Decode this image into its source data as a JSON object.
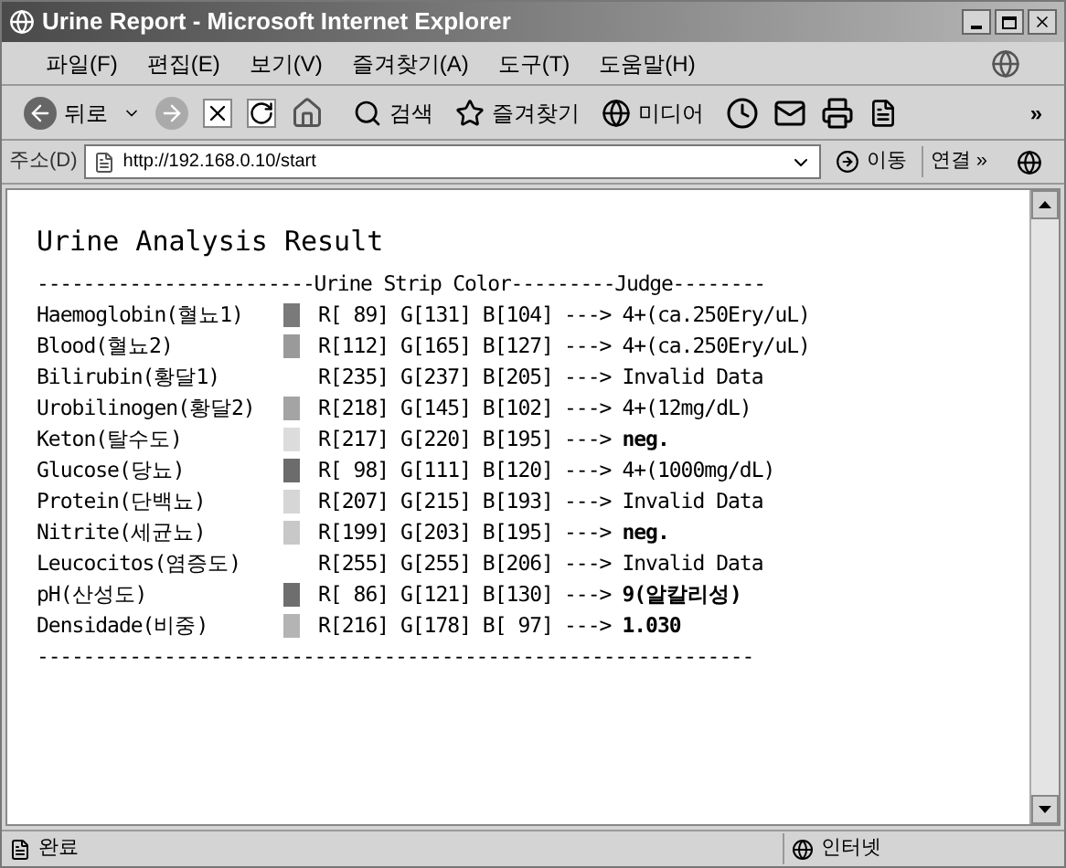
{
  "window": {
    "title": "Urine Report - Microsoft Internet Explorer"
  },
  "menu": [
    "파일(F)",
    "편집(E)",
    "보기(V)",
    "즐겨찾기(A)",
    "도구(T)",
    "도움말(H)"
  ],
  "toolbar": {
    "back": "뒤로",
    "search": "검색",
    "favorites": "즐겨찾기",
    "media": "미디어",
    "more": "»"
  },
  "address": {
    "label": "주소(D)",
    "value": "http://192.168.0.10/start",
    "go": "이동",
    "links": "연결 »"
  },
  "report": {
    "title": "Urine Analysis Result",
    "header": "------------------------Urine Strip Color---------Judge--------",
    "rows": [
      {
        "name": "Haemoglobin(혈뇨1)",
        "color": "#7a7a7a",
        "rgb": "R[ 89] G[131] B[104]",
        "arrow": "--->",
        "judge": "4+(ca.250Ery/uL)",
        "bold": false
      },
      {
        "name": "Blood(혈뇨2)",
        "color": "#9a9a9a",
        "rgb": "R[112] G[165] B[127]",
        "arrow": "--->",
        "judge": "4+(ca.250Ery/uL)",
        "bold": false
      },
      {
        "name": "Bilirubin(황달1)",
        "rgb": "R[235] G[237] B[205]",
        "arrow": "--->",
        "judge": "Invalid Data",
        "bold": false
      },
      {
        "name": "Urobilinogen(황달2)",
        "color": "#a4a4a4",
        "rgb": "R[218] G[145] B[102]",
        "arrow": "--->",
        "judge": "4+(12mg/dL)",
        "bold": false
      },
      {
        "name": "Keton(탈수도)",
        "color": "#dcdcdc",
        "rgb": "R[217] G[220] B[195]",
        "arrow": "--->",
        "judge": "neg.",
        "bold": true
      },
      {
        "name": "Glucose(당뇨)",
        "color": "#6c6c6c",
        "rgb": "R[ 98] G[111] B[120]",
        "arrow": "--->",
        "judge": "4+(1000mg/dL)",
        "bold": false
      },
      {
        "name": "Protein(단백뇨)",
        "color": "#d6d6d6",
        "rgb": "R[207] G[215] B[193]",
        "arrow": "--->",
        "judge": "Invalid Data",
        "bold": false
      },
      {
        "name": "Nitrite(세균뇨)",
        "color": "#c8c8c8",
        "rgb": "R[199] G[203] B[195]",
        "arrow": "--->",
        "judge": "neg.",
        "bold": true
      },
      {
        "name": "Leucocitos(염증도)",
        "rgb": "R[255] G[255] B[206]",
        "arrow": "--->",
        "judge": "Invalid Data",
        "bold": false
      },
      {
        "name": "pH(산성도)",
        "color": "#6e6e6e",
        "rgb": "R[ 86] G[121] B[130]",
        "arrow": "--->",
        "judge": "9(알칼리성)",
        "bold": true
      },
      {
        "name": "Densidade(비중)",
        "color": "#b4b4b4",
        "rgb": "R[216] G[178] B[ 97]",
        "arrow": "--->",
        "judge": "1.030",
        "bold": true
      }
    ],
    "footer": "--------------------------------------------------------------"
  },
  "status_bar": {
    "text": "완료",
    "zone": "인터넷"
  }
}
